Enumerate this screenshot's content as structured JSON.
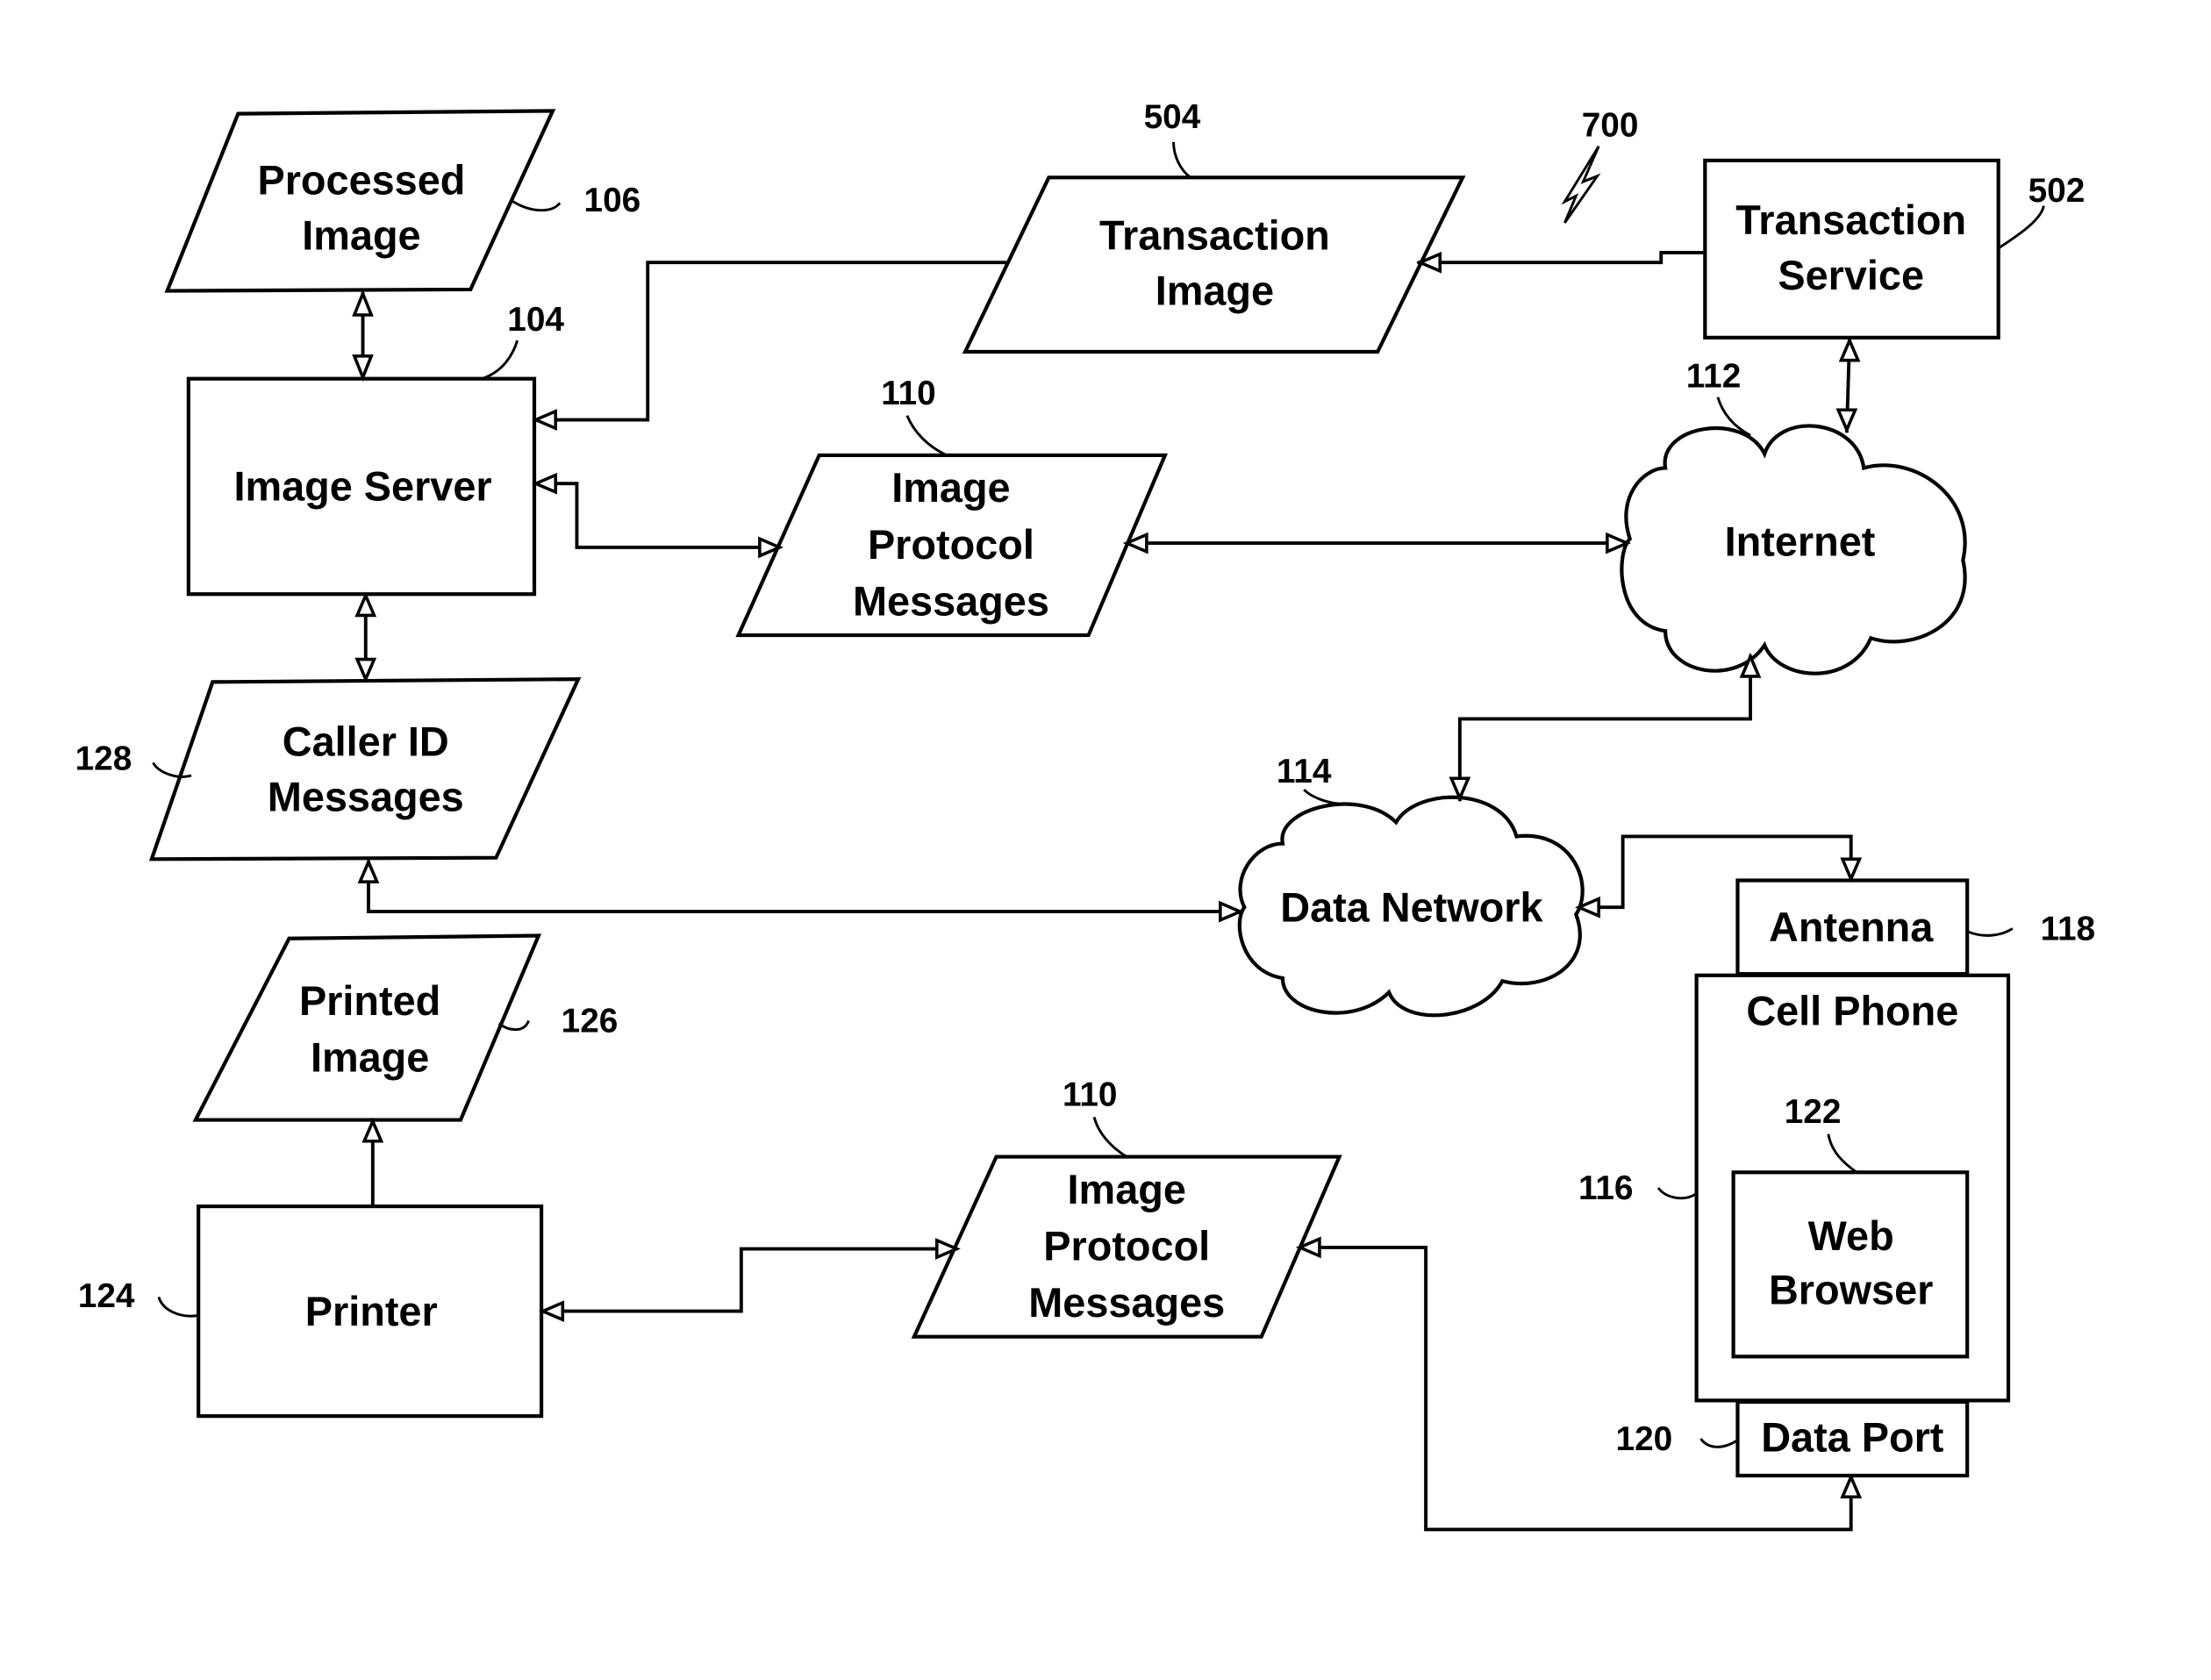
{
  "figure_ref": "700",
  "nodes": {
    "processed_image": {
      "lines": [
        "Processed",
        "Image"
      ],
      "ref": "106"
    },
    "image_server": {
      "lines": [
        "Image Server"
      ],
      "ref": "104"
    },
    "transaction_image": {
      "lines": [
        "Transaction",
        "Image"
      ],
      "ref": "504"
    },
    "transaction_service": {
      "lines": [
        "Transaction",
        "Service"
      ],
      "ref": "502"
    },
    "image_protocol_top": {
      "lines": [
        "Image",
        "Protocol",
        "Messages"
      ],
      "ref": "110"
    },
    "internet": {
      "lines": [
        "Internet"
      ],
      "ref": "112"
    },
    "caller_id": {
      "lines": [
        "Caller ID",
        "Messages"
      ],
      "ref": "128"
    },
    "data_network": {
      "lines": [
        "Data Network"
      ],
      "ref": "114"
    },
    "antenna": {
      "lines": [
        "Antenna"
      ],
      "ref": "118"
    },
    "cell_phone": {
      "lines": [
        "Cell Phone"
      ],
      "ref": "116"
    },
    "web_browser": {
      "lines": [
        "Web",
        "Browser"
      ],
      "ref": "122"
    },
    "data_port": {
      "lines": [
        "Data Port"
      ],
      "ref": "120"
    },
    "printed_image": {
      "lines": [
        "Printed",
        "Image"
      ],
      "ref": "126"
    },
    "printer": {
      "lines": [
        "Printer"
      ],
      "ref": "124"
    },
    "image_protocol_bottom": {
      "lines": [
        "Image",
        "Protocol",
        "Messages"
      ],
      "ref": "110"
    }
  }
}
